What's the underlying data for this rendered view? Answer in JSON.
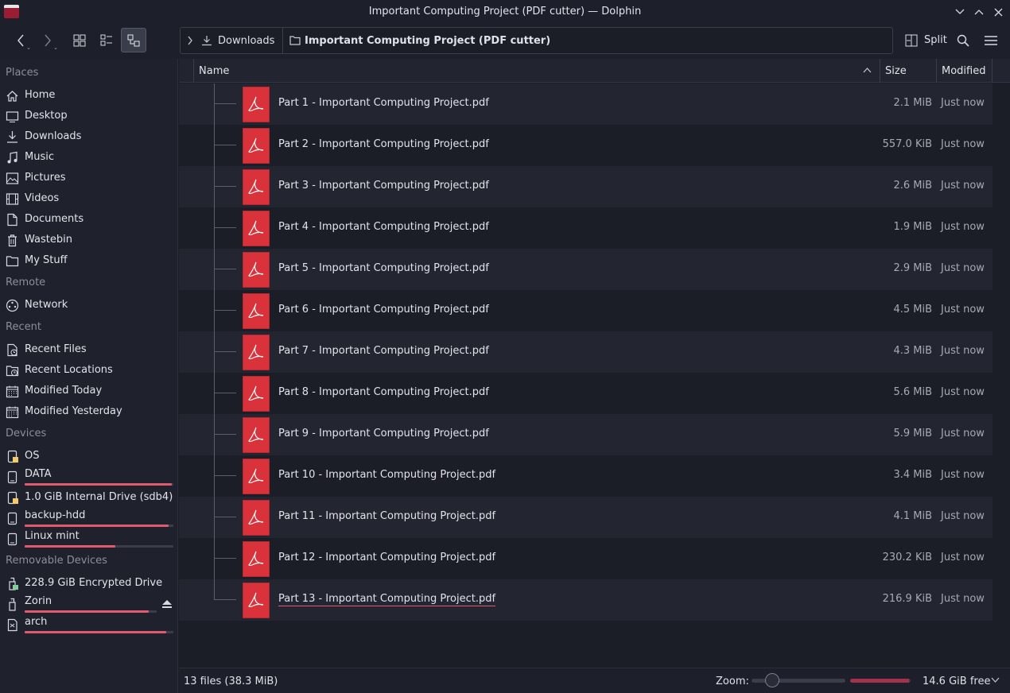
{
  "window": {
    "title": "Important Computing Project (PDF cutter) — Dolphin"
  },
  "toolbar": {
    "breadcrumb": [
      "Downloads",
      "Important Computing Project (PDF cutter)"
    ],
    "split_label": "Split"
  },
  "sidebar": {
    "sections": [
      {
        "title": "Places",
        "items": [
          {
            "label": "Home",
            "icon": "home-icon"
          },
          {
            "label": "Desktop",
            "icon": "desktop-icon"
          },
          {
            "label": "Downloads",
            "icon": "download-icon"
          },
          {
            "label": "Music",
            "icon": "music-icon"
          },
          {
            "label": "Pictures",
            "icon": "pictures-icon"
          },
          {
            "label": "Videos",
            "icon": "videos-icon"
          },
          {
            "label": "Documents",
            "icon": "documents-icon"
          },
          {
            "label": "Wastebin",
            "icon": "trash-icon"
          },
          {
            "label": "My Stuff",
            "icon": "folder-icon"
          }
        ]
      },
      {
        "title": "Remote",
        "items": [
          {
            "label": "Network",
            "icon": "network-icon"
          }
        ]
      },
      {
        "title": "Recent",
        "items": [
          {
            "label": "Recent Files",
            "icon": "recent-files-icon"
          },
          {
            "label": "Recent Locations",
            "icon": "recent-locations-icon"
          },
          {
            "label": "Modified Today",
            "icon": "calendar-icon"
          },
          {
            "label": "Modified Yesterday",
            "icon": "calendar-icon"
          }
        ]
      },
      {
        "title": "Devices",
        "items": [
          {
            "label": "OS",
            "icon": "drive-locked-icon"
          },
          {
            "label": "DATA",
            "icon": "drive-icon",
            "usage": 0.99
          },
          {
            "label": "1.0 GiB Internal Drive (sdb4)",
            "icon": "drive-locked-icon"
          },
          {
            "label": "backup-hdd",
            "icon": "drive-icon",
            "usage": 0.97
          },
          {
            "label": "Linux mint",
            "icon": "drive-icon",
            "usage": 0.61
          }
        ]
      },
      {
        "title": "Removable Devices",
        "items": [
          {
            "label": "228.9 GiB Encrypted Drive",
            "icon": "usb-locked-icon"
          },
          {
            "label": "Zorin",
            "icon": "usb-icon",
            "usage": 0.94,
            "eject": true
          },
          {
            "label": "arch",
            "icon": "sd-card-icon",
            "usage": 0.95
          }
        ]
      }
    ]
  },
  "columns": {
    "name": "Name",
    "size": "Size",
    "modified": "Modified"
  },
  "files": [
    {
      "name": "Part 1 - Important Computing Project.pdf",
      "size": "2.1 MiB",
      "modified": "Just now"
    },
    {
      "name": "Part 2 - Important Computing Project.pdf",
      "size": "557.0 KiB",
      "modified": "Just now"
    },
    {
      "name": "Part 3 - Important Computing Project.pdf",
      "size": "2.6 MiB",
      "modified": "Just now"
    },
    {
      "name": "Part 4 - Important Computing Project.pdf",
      "size": "1.9 MiB",
      "modified": "Just now"
    },
    {
      "name": "Part 5 - Important Computing Project.pdf",
      "size": "2.9 MiB",
      "modified": "Just now"
    },
    {
      "name": "Part 6 - Important Computing Project.pdf",
      "size": "4.5 MiB",
      "modified": "Just now"
    },
    {
      "name": "Part 7 - Important Computing Project.pdf",
      "size": "4.3 MiB",
      "modified": "Just now"
    },
    {
      "name": "Part 8 - Important Computing Project.pdf",
      "size": "5.6 MiB",
      "modified": "Just now"
    },
    {
      "name": "Part 9 - Important Computing Project.pdf",
      "size": "5.9 MiB",
      "modified": "Just now"
    },
    {
      "name": "Part 10 - Important Computing Project.pdf",
      "size": "3.4 MiB",
      "modified": "Just now"
    },
    {
      "name": "Part 11 - Important Computing Project.pdf",
      "size": "4.1 MiB",
      "modified": "Just now"
    },
    {
      "name": "Part 12 - Important Computing Project.pdf",
      "size": "230.2 KiB",
      "modified": "Just now"
    },
    {
      "name": "Part 13 - Important Computing Project.pdf",
      "size": "216.9 KiB",
      "modified": "Just now",
      "focused": true
    }
  ],
  "status": {
    "summary": "13 files (38.3 MiB)",
    "zoom_label": "Zoom:",
    "zoom_level": 0.22,
    "space_used": 0.98,
    "free_text": "14.6 GiB free"
  },
  "colors": {
    "accent": "#e05a70",
    "pdf": "#d9323b",
    "background": "#1b1d27"
  }
}
